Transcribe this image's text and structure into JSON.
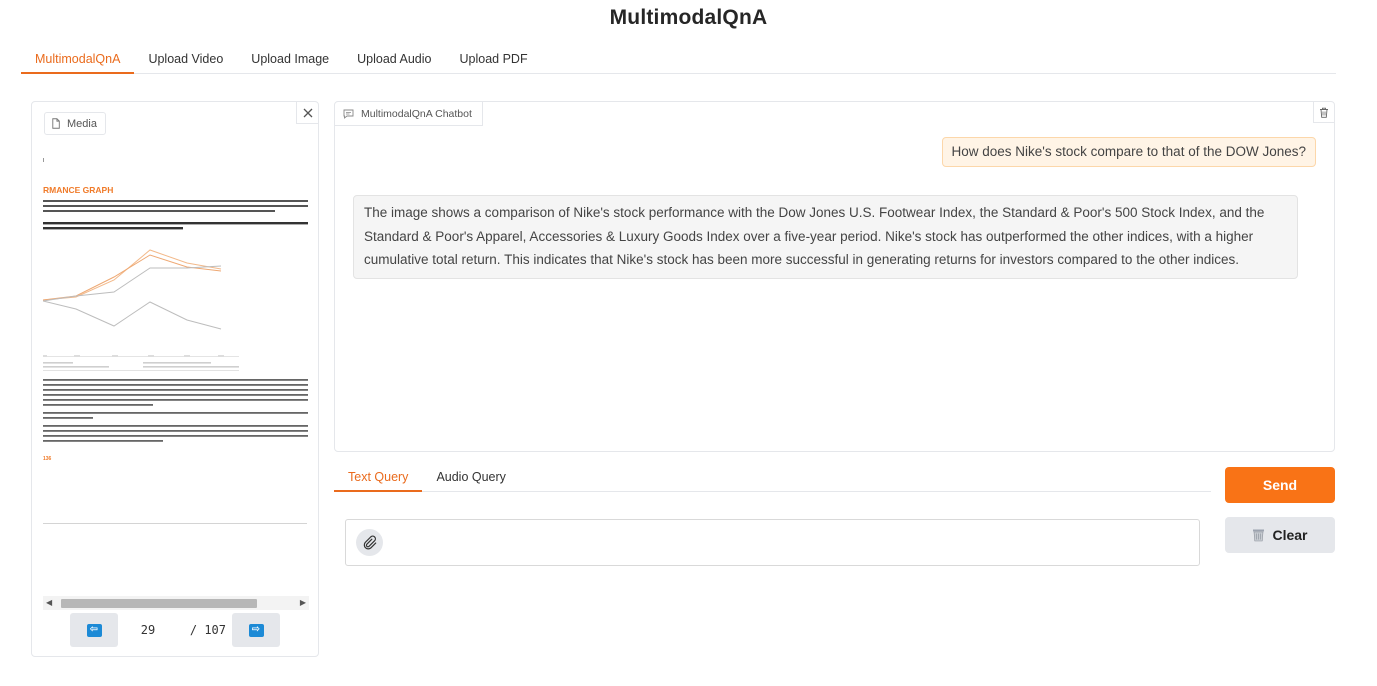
{
  "app": {
    "title": "MultimodalQnA"
  },
  "tabs": [
    {
      "label": "MultimodalQnA",
      "active": true
    },
    {
      "label": "Upload Video",
      "active": false
    },
    {
      "label": "Upload Image",
      "active": false
    },
    {
      "label": "Upload Audio",
      "active": false
    },
    {
      "label": "Upload PDF",
      "active": false
    }
  ],
  "media": {
    "label": "Media",
    "close_icon": "close-icon",
    "pdf": {
      "heading": "RMANCE GRAPH",
      "page": "29",
      "total": "/ 107",
      "prev_icon": "arrow-left-icon",
      "next_icon": "arrow-right-icon",
      "footer_marker": "136"
    }
  },
  "chat": {
    "label": "MultimodalQnA Chatbot",
    "messages": [
      {
        "role": "user",
        "text": "How does Nike's stock compare to that of the DOW Jones?"
      },
      {
        "role": "bot",
        "text": "The image shows a comparison of Nike's stock performance with the Dow Jones U.S. Footwear Index, the Standard & Poor's 500 Stock Index, and the Standard & Poor's Apparel, Accessories & Luxury Goods Index over a five-year period. Nike's stock has outperformed the other indices, with a higher cumulative total return. This indicates that Nike's stock has been more successful in generating returns for investors compared to the other indices."
      }
    ]
  },
  "query": {
    "tabs": [
      {
        "label": "Text Query",
        "active": true
      },
      {
        "label": "Audio Query",
        "active": false
      }
    ],
    "input_value": "",
    "attach_icon": "paperclip-icon"
  },
  "actions": {
    "send_label": "Send",
    "clear_label": "Clear"
  },
  "colors": {
    "accent": "#f97316",
    "accent_text": "#ea6b1d",
    "pager_blue": "#1c8ad6"
  }
}
